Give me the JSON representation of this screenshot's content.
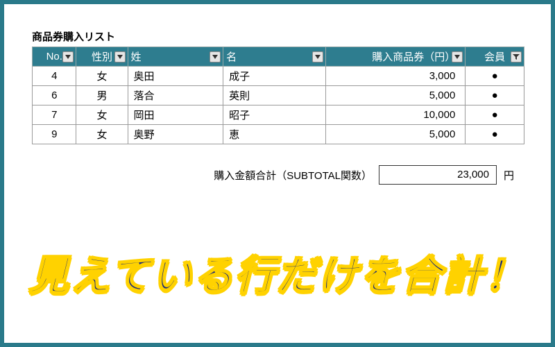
{
  "title": "商品券購入リスト",
  "columns": {
    "no": "No.",
    "sex": "性別",
    "sei": "姓",
    "mei": "名",
    "amount": "購入商品券（円）",
    "member": "会員"
  },
  "rows": [
    {
      "no": "4",
      "sex": "女",
      "sei": "奥田",
      "mei": "成子",
      "amount": "3,000",
      "member": "●"
    },
    {
      "no": "6",
      "sex": "男",
      "sei": "落合",
      "mei": "英則",
      "amount": "5,000",
      "member": "●"
    },
    {
      "no": "7",
      "sex": "女",
      "sei": "岡田",
      "mei": "昭子",
      "amount": "10,000",
      "member": "●"
    },
    {
      "no": "9",
      "sex": "女",
      "sei": "奥野",
      "mei": "恵",
      "amount": "5,000",
      "member": "●"
    }
  ],
  "total": {
    "label": "購入金額合計（SUBTOTAL関数）",
    "value": "23,000",
    "unit": "円"
  },
  "headline": "見えている行だけを合計！",
  "chart_data": {
    "type": "table",
    "title": "商品券購入リスト",
    "columns": [
      "No.",
      "性別",
      "姓",
      "名",
      "購入商品券（円）",
      "会員"
    ],
    "rows": [
      [
        4,
        "女",
        "奥田",
        "成子",
        3000,
        true
      ],
      [
        6,
        "男",
        "落合",
        "英則",
        5000,
        true
      ],
      [
        7,
        "女",
        "岡田",
        "昭子",
        10000,
        true
      ],
      [
        9,
        "女",
        "奥野",
        "恵",
        5000,
        true
      ]
    ],
    "subtotal": 23000,
    "subtotal_label": "購入金額合計（SUBTOTAL関数）",
    "note": "見えている行だけを合計！"
  }
}
